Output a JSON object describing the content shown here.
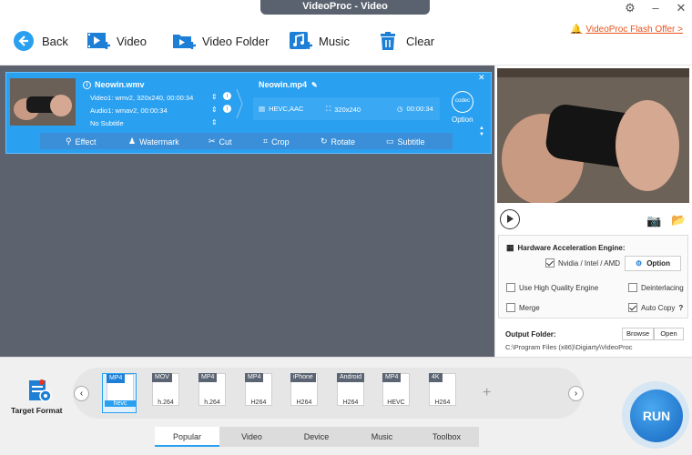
{
  "window": {
    "title": "VideoProc - Video"
  },
  "toolbar": {
    "back": "Back",
    "video": "Video",
    "video_folder": "Video Folder",
    "music": "Music",
    "clear": "Clear",
    "offer": "VideoProc Flash Offer >"
  },
  "item": {
    "source_name": "Neowin.wmv",
    "video_info": "Video1: wmv2, 320x240, 00:00:34",
    "audio_info": "Audio1: wmav2, 00:00:34",
    "subtitle": "No Subtitle",
    "output_name": "Neowin.mp4",
    "codec": "HEVC,AAC",
    "resolution": "320x240",
    "duration": "00:00:34",
    "codec_badge": "codec",
    "option": "Option"
  },
  "edit": {
    "effect": "Effect",
    "watermark": "Watermark",
    "cut": "Cut",
    "crop": "Crop",
    "rotate": "Rotate",
    "subtitle": "Subtitle"
  },
  "settings": {
    "hw_title": "Hardware Acceleration Engine:",
    "hw_vendors": "Nvidia / Intel / AMD",
    "hw_vendors_checked": true,
    "option_button": "Option",
    "high_quality": "Use High Quality Engine",
    "high_quality_checked": false,
    "deinterlacing": "Deinterlacing",
    "deinterlacing_checked": false,
    "merge": "Merge",
    "merge_checked": false,
    "auto_copy": "Auto Copy",
    "auto_copy_checked": true,
    "help": "?",
    "output_folder_label": "Output Folder:",
    "browse": "Browse",
    "open": "Open",
    "output_path": "C:\\Program Files (x86)\\Digiarty\\VideoProc"
  },
  "target": {
    "label": "Target Format"
  },
  "formats": [
    {
      "top": "MP4",
      "sub": "hevc",
      "selected": true
    },
    {
      "top": "MOV",
      "sub": "h.264",
      "selected": false
    },
    {
      "top": "MP4",
      "sub": "h.264",
      "selected": false
    },
    {
      "top": "MP4",
      "sub": "H264",
      "selected": false
    },
    {
      "top": "iPhone",
      "sub": "H264",
      "selected": false
    },
    {
      "top": "Android",
      "sub": "H264",
      "selected": false
    },
    {
      "top": "MP4",
      "sub": "HEVC",
      "selected": false
    },
    {
      "top": "4K",
      "sub": "H264",
      "selected": false
    }
  ],
  "tabs": [
    "Popular",
    "Video",
    "Device",
    "Music",
    "Toolbox"
  ],
  "active_tab": "Popular",
  "run": "RUN",
  "colors": {
    "accent": "#2aa0f0",
    "offer": "#e8541e",
    "run": "#1e7fd6"
  }
}
